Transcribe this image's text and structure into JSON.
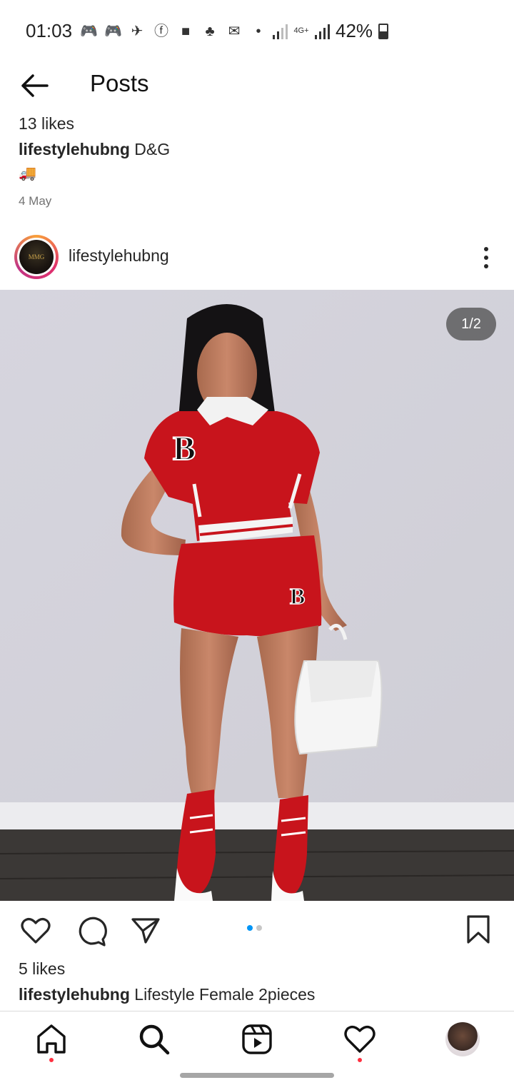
{
  "status_bar": {
    "time": "01:03",
    "network": "4G+",
    "battery": "42%",
    "notification_icons": [
      "discord-icon",
      "discord-icon",
      "telegram-icon",
      "facebook-icon",
      "facebook-icon",
      "clean-icon",
      "mail-icon",
      "dot-icon"
    ]
  },
  "header": {
    "title": "Posts"
  },
  "previous_post": {
    "likes": "13 likes",
    "username": "lifestylehubng",
    "caption": " D&G",
    "emoji": "🚚",
    "date": "4 May"
  },
  "post": {
    "username": "lifestylehubng",
    "avatar_text": "MMG",
    "image_counter": "1/2",
    "carousel": {
      "total": 2,
      "active": 1
    },
    "likes": "5 likes",
    "caption": " Lifestyle Female 2pieces"
  },
  "colors": {
    "text": "#262626",
    "muted": "#737373",
    "accent_blue": "#0095f6",
    "notification_red": "#ff3040",
    "outfit_red": "#c8141c"
  },
  "nav": {
    "items": [
      "home-icon",
      "search-icon",
      "reels-icon",
      "activity-icon",
      "profile-avatar"
    ]
  }
}
